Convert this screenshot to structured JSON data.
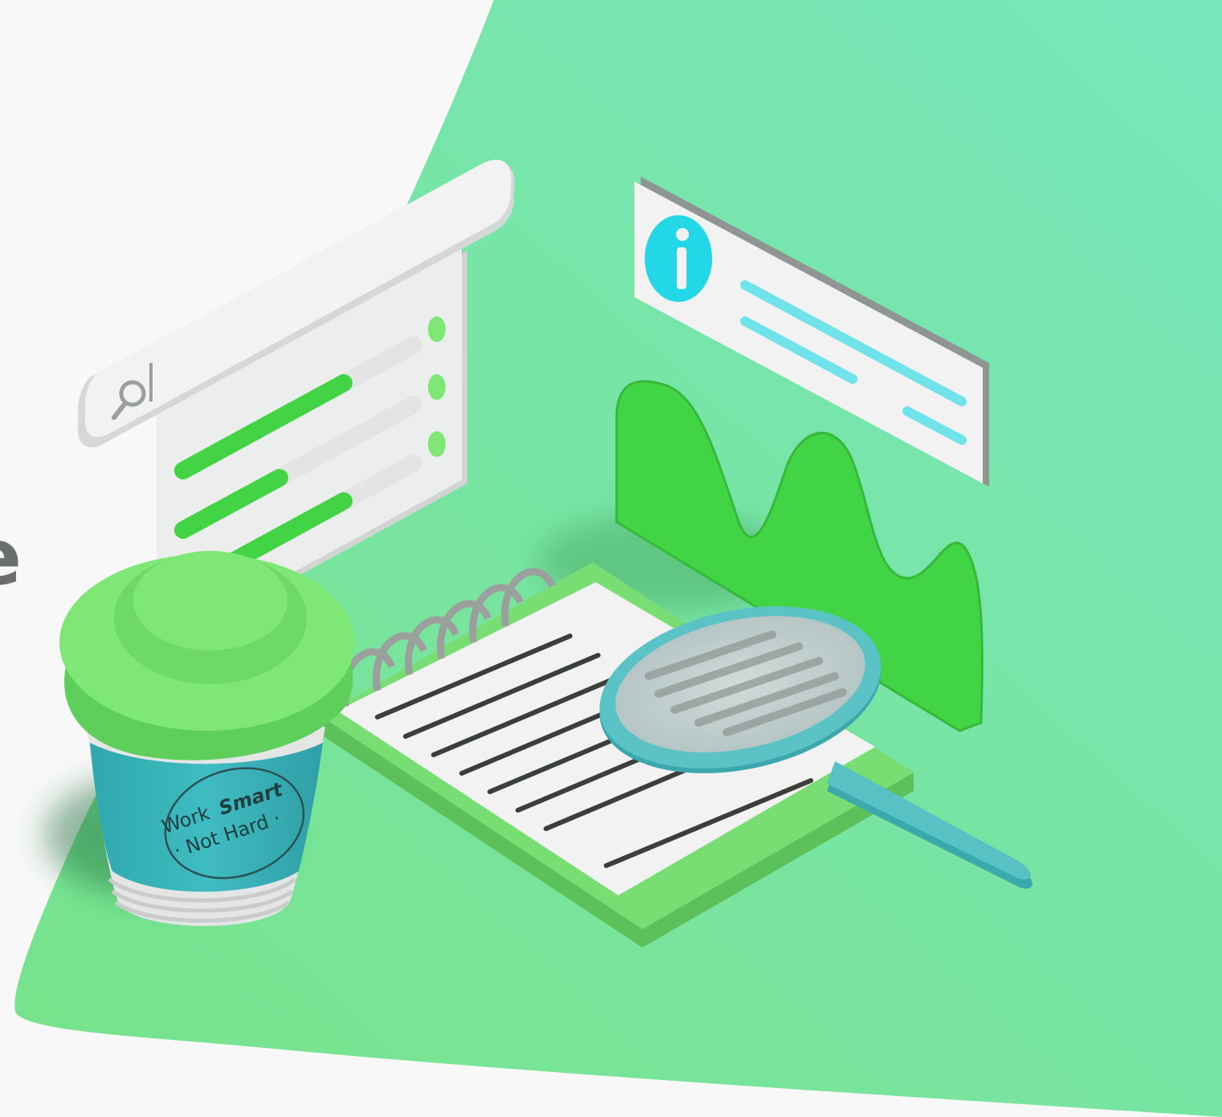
{
  "hero_illustration": {
    "clipped_text_fragments": [
      ",",
      "e"
    ],
    "cup_text_line1_a": "Work",
    "cup_text_line1_b": "Smart",
    "cup_text_line2": "· Not Hard ·",
    "icons": {
      "search": "search-icon",
      "info": "info-icon",
      "magnifier": "magnifying-glass-icon"
    },
    "colors": {
      "blob_green": "#78e395",
      "blob_teal": "#77e6b9",
      "bright_green": "#42d445",
      "light_green": "#7fe776",
      "teal": "#3dbcc0",
      "cyan": "#24d7e6",
      "panel_white": "#f2f2f2",
      "page_bg": "#f7f8f7"
    },
    "search_panel_progress": [
      0.58,
      0.42,
      0.58
    ]
  }
}
